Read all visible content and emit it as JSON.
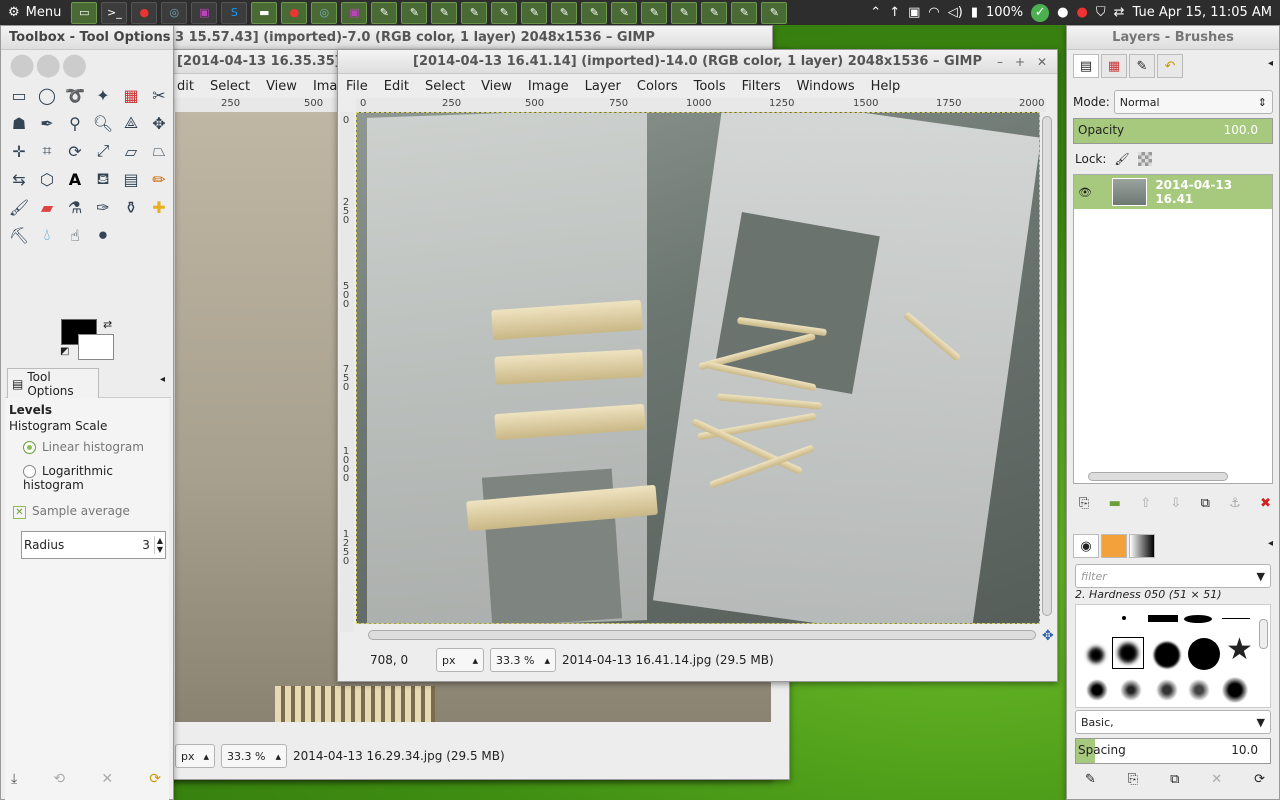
{
  "panel": {
    "menu_label": "Menu",
    "clock": "Tue Apr 15, 11:05 AM",
    "battery": "100%",
    "tray_icons": [
      "chevron-up-icon",
      "up-arrow-icon",
      "dropbox-icon",
      "wifi-icon",
      "volume-icon",
      "battery-icon",
      "check-icon",
      "network-icon",
      "chrome-icon",
      "shield-icon",
      "swap-icon"
    ]
  },
  "toolbox": {
    "title": "Toolbox - Tool Options",
    "tool_options_tab": "Tool Options",
    "section": "Levels",
    "histogram_scale_label": "Histogram Scale",
    "linear": "Linear histogram",
    "logarithmic": "Logarithmic histogram",
    "sample_average": "Sample average",
    "radius_label": "Radius",
    "radius_value": "3"
  },
  "back_window": {
    "title": "[2014-04-13 15.57.43] (imported)-7.0 (RGB color, 1 layer) 2048x1536 – GIMP",
    "title_visible": "3 15.57.43] (imported)-7.0 (RGB color, 1 layer) 2048x1536 – GIMP"
  },
  "mid_window": {
    "title_visible": "[2014-04-13 16.35.35] (i",
    "menu": [
      "dit",
      "Select",
      "View",
      "Image"
    ],
    "ruler": [
      "250",
      "500"
    ],
    "unit": "px",
    "zoom": "33.3 %",
    "status": "2014-04-13 16.29.34.jpg (29.5 MB)"
  },
  "front_window": {
    "title": "[2014-04-13 16.41.14] (imported)-14.0 (RGB color, 1 layer) 2048x1536 – GIMP",
    "menu": [
      "File",
      "Edit",
      "Select",
      "View",
      "Image",
      "Layer",
      "Colors",
      "Tools",
      "Filters",
      "Windows",
      "Help"
    ],
    "hruler": [
      "0",
      "250",
      "500",
      "750",
      "1000",
      "1250",
      "1500",
      "1750",
      "2000"
    ],
    "vruler": [
      "0",
      "250",
      "500",
      "750",
      "1000",
      "1250"
    ],
    "coords": "708, 0",
    "unit": "px",
    "zoom": "33.3 %",
    "status": "2014-04-13 16.41.14.jpg (29.5 MB)"
  },
  "layers_dock": {
    "title": "Layers - Brushes",
    "mode_label": "Mode:",
    "mode_value": "Normal",
    "opacity_label": "Opacity",
    "opacity_value": "100.0",
    "opacity_fraction": 1.0,
    "lock_label": "Lock:",
    "layer_name": "2014-04-13 16.41",
    "brush_filter_placeholder": "filter",
    "brush_name": "2. Hardness 050 (51 × 51)",
    "brush_tag": "Basic,",
    "spacing_label": "Spacing",
    "spacing_value": "10.0",
    "spacing_fraction": 0.1
  }
}
